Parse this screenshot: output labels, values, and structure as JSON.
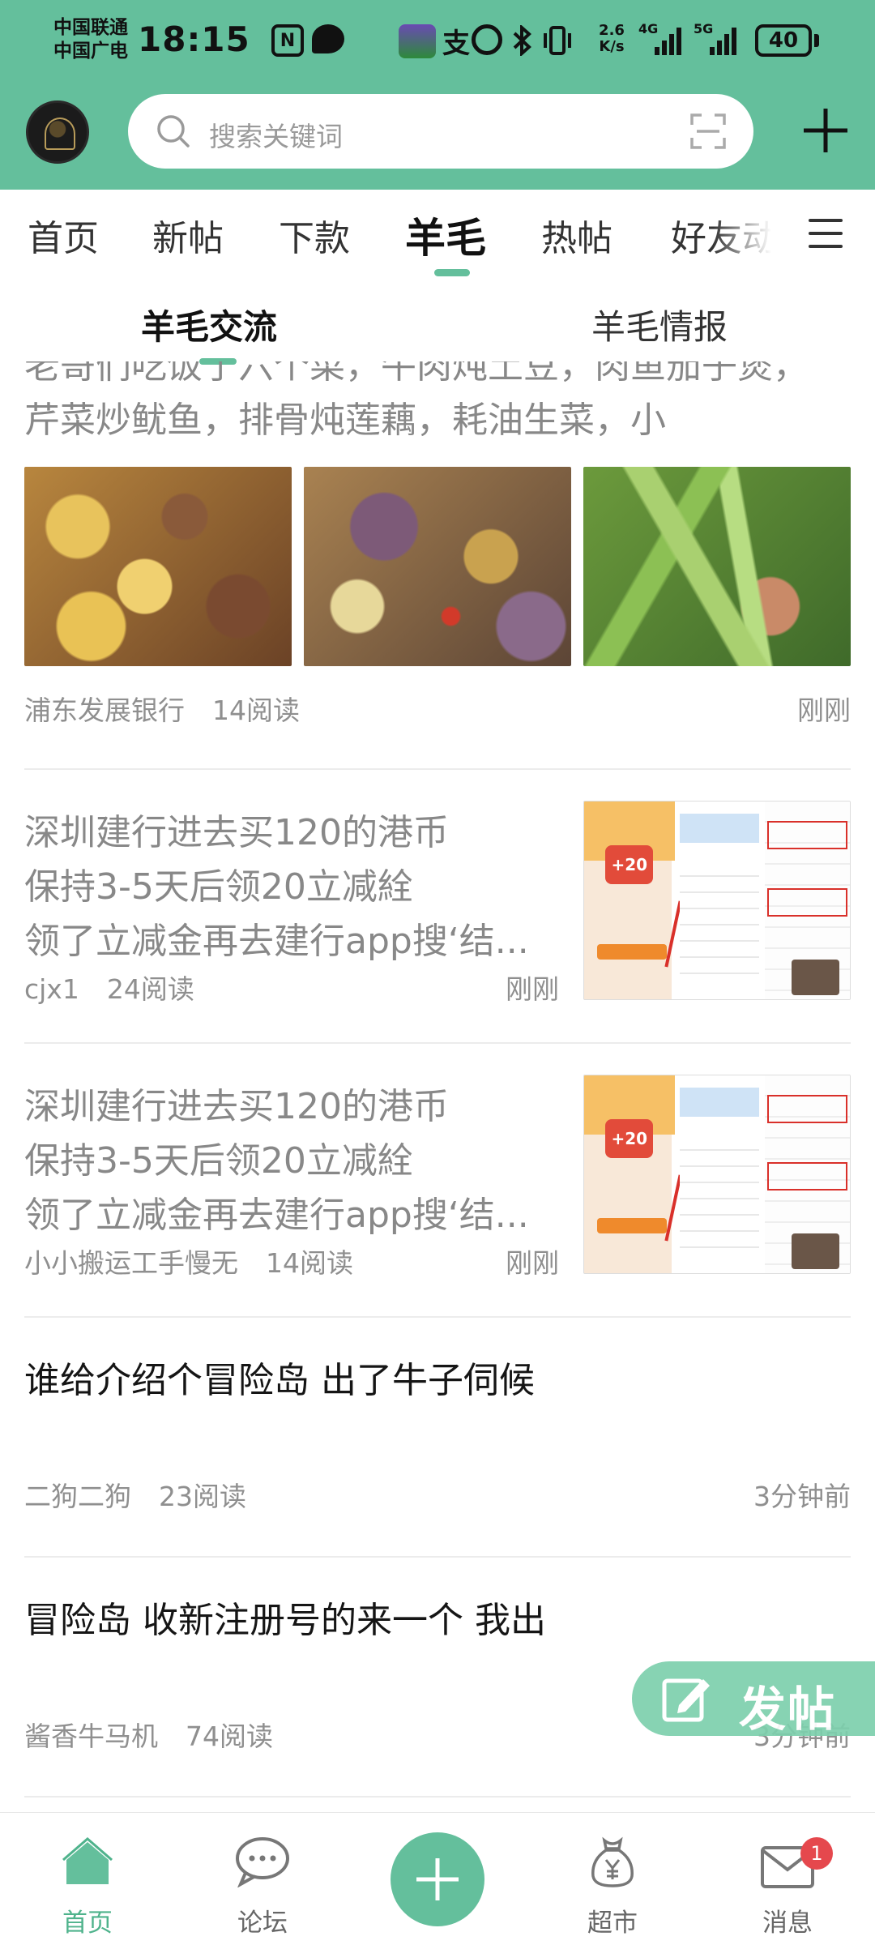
{
  "status_bar": {
    "carrier_line1": "中国联通",
    "carrier_line2": "中国广电",
    "time": "18:15",
    "nfc_icon": "N",
    "alipay_icon": "支",
    "speed_value": "2.6",
    "speed_unit": "K/s",
    "network_4g": "4G",
    "network_5g": "5G",
    "battery": "40"
  },
  "header": {
    "search_placeholder": "搜索关键词",
    "accent_color": "#64bf9c"
  },
  "tabs": [
    {
      "label": "首页",
      "active": false
    },
    {
      "label": "新帖",
      "active": false
    },
    {
      "label": "下款",
      "active": false
    },
    {
      "label": "羊毛",
      "active": true
    },
    {
      "label": "热帖",
      "active": false
    },
    {
      "label": "好友动",
      "active": false
    }
  ],
  "subtabs": [
    {
      "label": "羊毛交流",
      "active": true
    },
    {
      "label": "羊毛情报",
      "active": false
    }
  ],
  "posts": [
    {
      "text_partial": "老哥们吃饭了六个菜，牛肉炖土豆，肉鱼茄子煲，",
      "text": "芹菜炒鱿鱼，排骨炖莲藕，耗油生菜，小",
      "author": "浦东发展银行",
      "reads": "14阅读",
      "time": "刚刚"
    },
    {
      "text_lines": [
        "深圳建行进去买120的港币",
        "保持3-5天后领20立减絟",
        "领了立减金再去建行app搜‘结..."
      ],
      "author": "cjx1",
      "reads": "24阅读",
      "time": "刚刚",
      "thumb_badge": "+20"
    },
    {
      "text_lines": [
        "深圳建行进去买120的港币",
        "保持3-5天后领20立减絟",
        "领了立减金再去建行app搜‘结..."
      ],
      "author": "小小搬运工手慢无",
      "reads": "14阅读",
      "time": "刚刚",
      "thumb_badge": "+20"
    },
    {
      "title": "谁给介绍个冒险岛 出了牛子伺候",
      "author": "二狗二狗",
      "reads": "23阅读",
      "time": "3分钟前"
    },
    {
      "title": "冒险岛 收新注册号的来一个 我出",
      "author": "酱香牛马机",
      "reads": "74阅读",
      "time": "3分钟前"
    }
  ],
  "fab": {
    "label": "发帖"
  },
  "bottom_nav": [
    {
      "label": "首页",
      "icon": "home-icon",
      "active": true
    },
    {
      "label": "论坛",
      "icon": "forum-chat-icon",
      "active": false
    },
    {
      "label": "",
      "icon": "plus-icon",
      "active": false
    },
    {
      "label": "超市",
      "icon": "market-bag-icon",
      "active": false
    },
    {
      "label": "消息",
      "icon": "mail-icon",
      "active": false,
      "badge": "1"
    }
  ]
}
